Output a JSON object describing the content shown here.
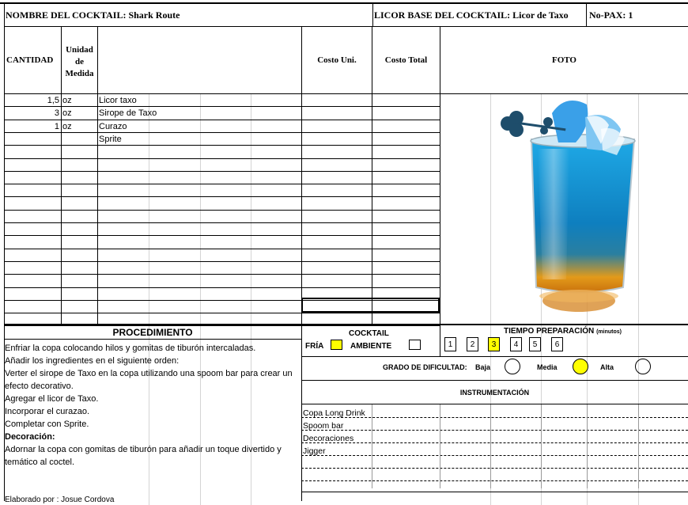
{
  "header": {
    "cocktail_name": "NOMBRE DEL COCKTAIL: Shark Route",
    "base_liquor": "LICOR BASE DEL COCKTAIL: Licor de Taxo",
    "pax": "No-PAX: 1"
  },
  "columns": {
    "cantidad": "CANTIDAD",
    "unidad_1": "Unidad",
    "unidad_2": "de",
    "unidad_3": "Medida",
    "costo_uni": "Costo Uni.",
    "costo_total": "Costo Total",
    "foto": "FOTO"
  },
  "ingredients": [
    {
      "qty": "1,5",
      "unit": "oz",
      "name": "Licor taxo"
    },
    {
      "qty": "3",
      "unit": "oz",
      "name": "Sirope de Taxo"
    },
    {
      "qty": "1",
      "unit": "oz",
      "name": "Curazo"
    },
    {
      "qty": "",
      "unit": "",
      "name": "Sprite"
    }
  ],
  "procedure": {
    "title": "PROCEDIMIENTO",
    "lines": [
      "Enfriar la copa colocando hilos y gomitas de tiburón intercaladas.",
      "Añadir los ingredientes en el siguiente orden:",
      "Verter el sirope de Taxo en la copa utilizando una spoom bar para crear un",
      "efecto decorativo.",
      "Agregar el licor de Taxo.",
      "Incorporar el curazao.",
      "Completar con Sprite."
    ],
    "decoration_label": "Decoración:",
    "decoration_lines": [
      "Adornar la copa con gomitas de tiburón para añadir un toque divertido y",
      "temático al coctel."
    ],
    "author": "Elaborado por : Josue Cordova"
  },
  "cocktail_type": {
    "title": "COCKTAIL",
    "fria": "FRÍA",
    "ambiente": "AMBIENTE",
    "selected": "FRÍA",
    "highlight_color": "#ffff00"
  },
  "prep_time": {
    "title": "TIEMPO PREPARACIÓN",
    "unit": "(minutos)",
    "options": [
      "1",
      "2",
      "3",
      "4",
      "5",
      "6"
    ],
    "selected": "3"
  },
  "difficulty": {
    "label": "GRADO DE DIFICULTAD:",
    "levels": [
      "Baja",
      "Media",
      "Alta"
    ],
    "selected": "Media"
  },
  "instrumentation": {
    "title": "INSTRUMENTACIÓN",
    "items": [
      "Copa Long Drink",
      "Spoom bar",
      "Decoraciones",
      "Jigger"
    ]
  },
  "photo": {
    "icon": "cocktail-glass-photo",
    "liquid_top_color": "#1fa9e6",
    "liquid_bottom_color": "#e39a1a"
  }
}
